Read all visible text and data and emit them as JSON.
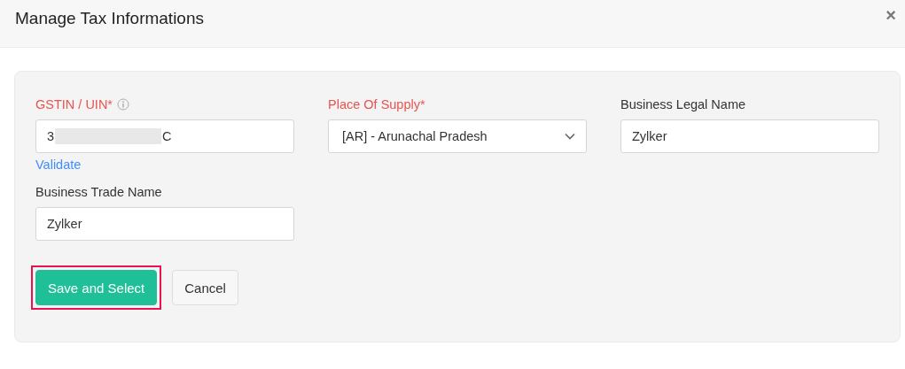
{
  "window": {
    "title": "Manage Tax Informations",
    "close": "×"
  },
  "fields": [
    {
      "kind": "text",
      "label": "GSTIN / UIN*",
      "required": true,
      "info": true,
      "value_start": "3",
      "value_end": "C",
      "redacted": true,
      "link": "Validate"
    },
    {
      "kind": "select",
      "label": "Place Of Supply*",
      "required": true,
      "info": false,
      "value": "[AR] - Arunachal Pradesh"
    },
    {
      "kind": "text",
      "label": "Business Legal Name",
      "required": false,
      "info": false,
      "value": "Zylker"
    },
    {
      "kind": "text",
      "label": "Business Trade Name",
      "required": false,
      "info": false,
      "value": "Zylker"
    }
  ],
  "buttons": [
    {
      "label": "Save and Select",
      "kind": "primary",
      "highlighted": true
    },
    {
      "label": "Cancel",
      "kind": "secondary",
      "highlighted": false
    }
  ]
}
